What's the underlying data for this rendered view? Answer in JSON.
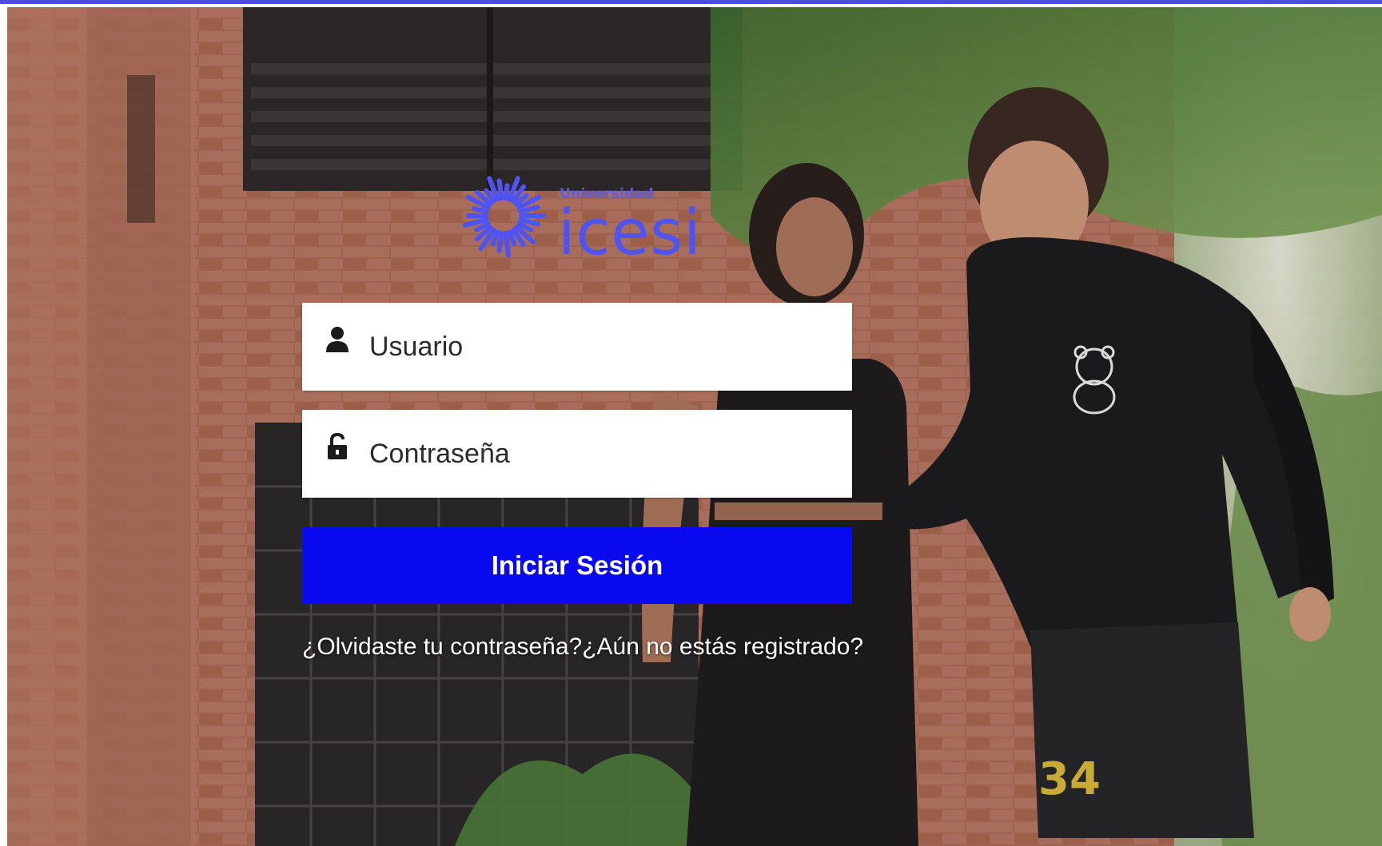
{
  "logo": {
    "small_text": "Universidad",
    "brand_text": "icesi",
    "color": "#4f53f2"
  },
  "login_form": {
    "username": {
      "placeholder": "Usuario",
      "value": "",
      "icon": "user-icon"
    },
    "password": {
      "placeholder": "Contraseña",
      "value": "",
      "icon": "lock-icon"
    },
    "submit_label": "Iniciar Sesión",
    "submit_color": "#0a0af0"
  },
  "links": {
    "forgot_password": "¿Olvidaste tu contraseña?",
    "register": "¿Aún no estás registrado?"
  },
  "colors": {
    "top_bar": "#4a4fe0"
  }
}
